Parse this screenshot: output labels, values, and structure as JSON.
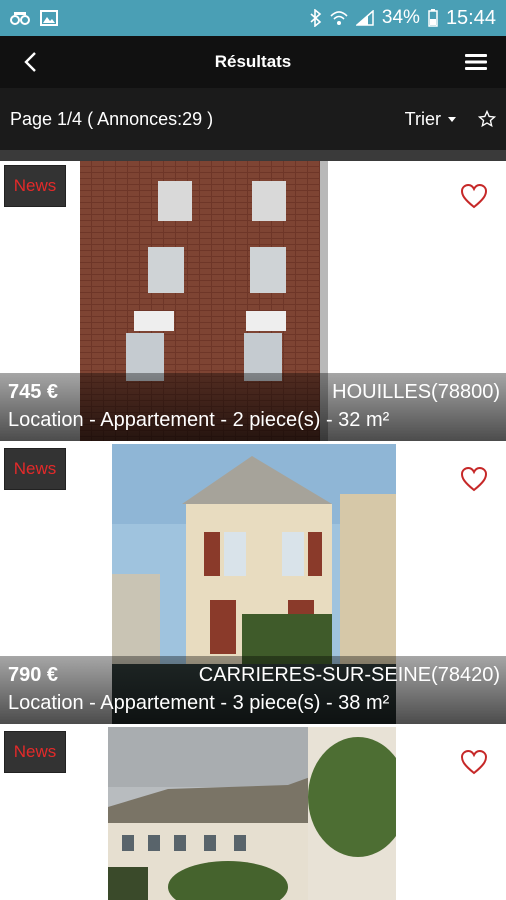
{
  "status_bar": {
    "battery_pct": "34%",
    "time": "15:44"
  },
  "app_bar": {
    "title": "Résultats"
  },
  "sub_bar": {
    "page_info": "Page 1/4 ( Annonces:29 )",
    "sort_label": "Trier"
  },
  "listings": [
    {
      "badge": "News",
      "price": "745 €",
      "city": "HOUILLES(78800)",
      "description": "Location - Appartement - 2 piece(s) - 32 m²"
    },
    {
      "badge": "News",
      "price": "790 €",
      "city": "CARRIERES-SUR-SEINE(78420)",
      "description": "Location - Appartement - 3 piece(s) - 38 m²"
    },
    {
      "badge": "News"
    }
  ],
  "colors": {
    "status_bar": "#4a9fb5",
    "app_bar": "#111111",
    "badge_text": "#e32a2a",
    "heart": "#c62828"
  }
}
